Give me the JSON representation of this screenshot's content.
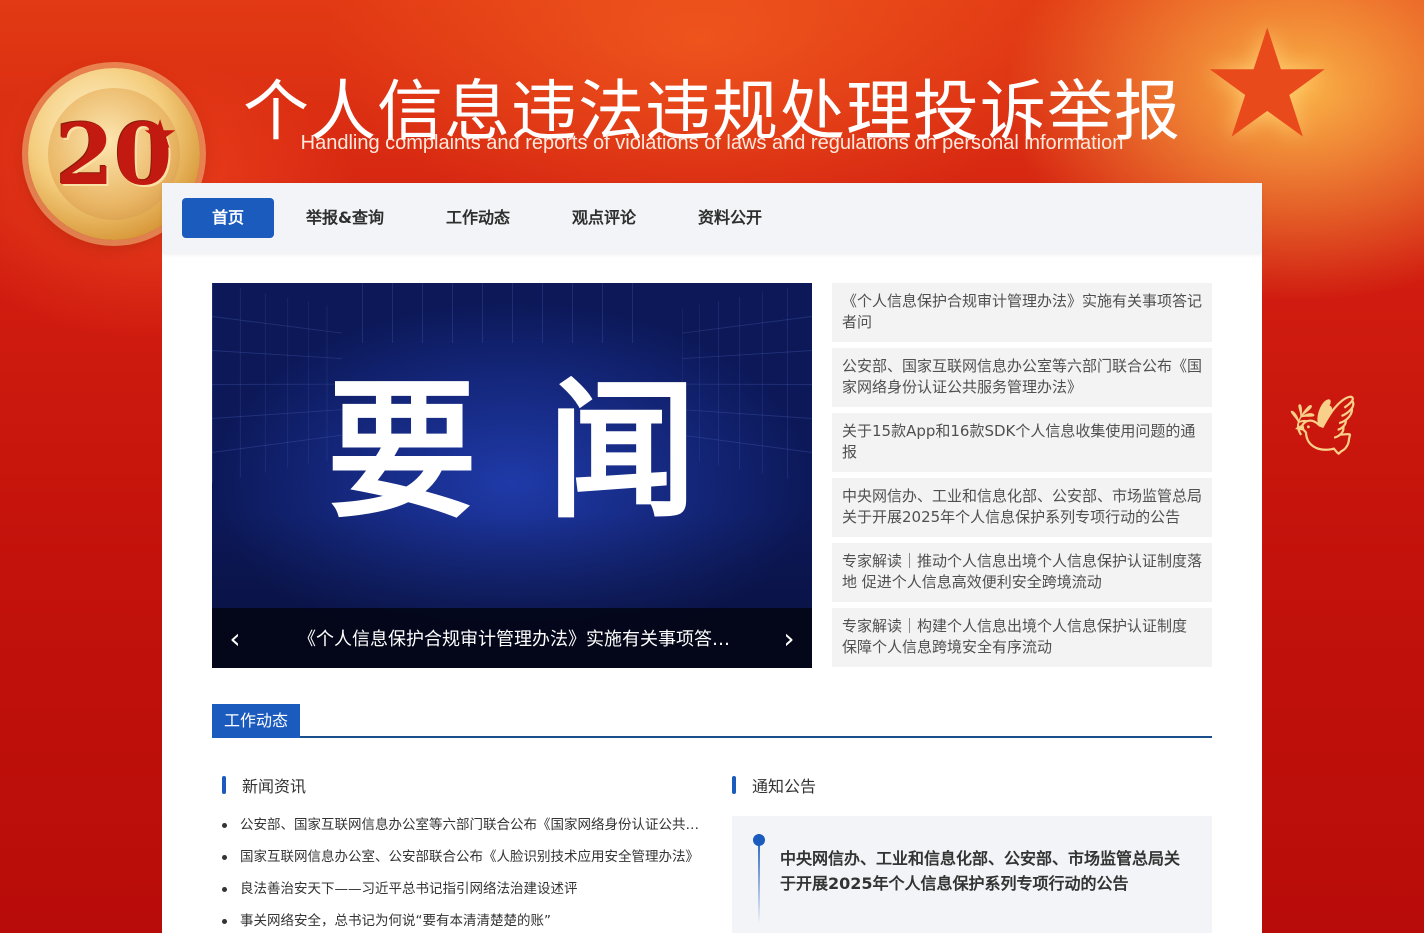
{
  "header": {
    "title": "个人信息违法违规处理投诉举报",
    "subtitle": "Handling complaints and reports of violations of laws and regulations on personal information",
    "badge_number": "20"
  },
  "nav": {
    "items": [
      {
        "label": "首页",
        "active": true
      },
      {
        "label": "举报&查询",
        "active": false
      },
      {
        "label": "工作动态",
        "active": false
      },
      {
        "label": "观点评论",
        "active": false
      },
      {
        "label": "资料公开",
        "active": false
      }
    ]
  },
  "carousel": {
    "image_text": "要闻",
    "caption": "《个人信息保护合规审计管理办法》实施有关事项答记者问",
    "prev_icon": "chevron-left-icon",
    "next_icon": "chevron-right-icon"
  },
  "headlines": [
    "《个人信息保护合规审计管理办法》实施有关事项答记者问",
    "公安部、国家互联网信息办公室等六部门联合公布《国家网络身份认证公共服务管理办法》",
    "关于15款App和16款SDK个人信息收集使用问题的通报",
    "中央网信办、工业和信息化部、公安部、市场监管总局关于开展2025年个人信息保护系列专项行动的公告",
    "专家解读｜推动个人信息出境个人信息保护认证制度落地 促进个人信息高效便利安全跨境流动",
    "专家解读｜构建个人信息出境个人信息保护认证制度 保障个人信息跨境安全有序流动"
  ],
  "section": {
    "tab": "工作动态",
    "news_title": "新闻资讯",
    "notice_title": "通知公告"
  },
  "news": [
    "公安部、国家互联网信息办公室等六部门联合公布《国家网络身份认证公共服务管理办法》",
    "国家互联网信息办公室、公安部联合公布《人脸识别技术应用安全管理办法》",
    "良法善治安天下——习近平总书记指引网络法治建设述评",
    "事关网络安全，总书记为何说“要有本清清楚楚的账”"
  ],
  "notice": {
    "text": "中央网信办、工业和信息化部、公安部、市场监管总局关于开展2025年个人信息保护系列专项行动的公告"
  },
  "colors": {
    "primary": "#1a5bbd",
    "header_red": "#c8160d",
    "divider": "#1b4f8c"
  }
}
